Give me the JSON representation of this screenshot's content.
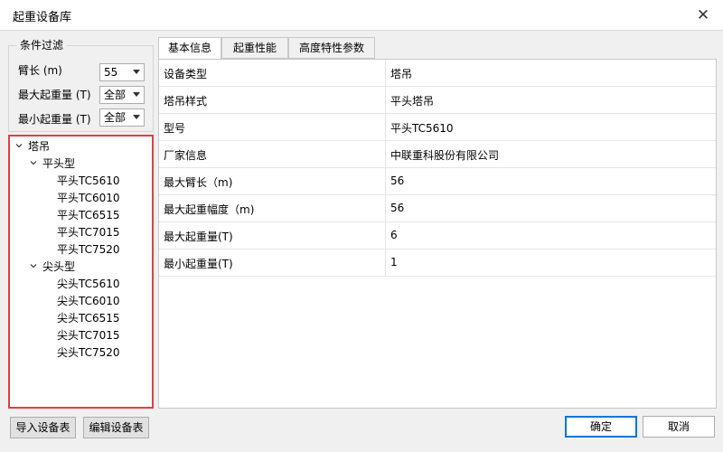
{
  "window": {
    "title": "起重设备库"
  },
  "filter": {
    "legend": "条件过滤",
    "fields": [
      {
        "label": "臂长 (m)",
        "value": "55"
      },
      {
        "label": "最大起重量 (T)",
        "value": "全部"
      },
      {
        "label": "最小起重量 (T)",
        "value": "全部"
      }
    ]
  },
  "tree": {
    "root": "塔吊",
    "groups": [
      {
        "label": "平头型",
        "items": [
          "平头TC5610",
          "平头TC6010",
          "平头TC6515",
          "平头TC7015",
          "平头TC7520"
        ]
      },
      {
        "label": "尖头型",
        "items": [
          "尖头TC5610",
          "尖头TC6010",
          "尖头TC6515",
          "尖头TC7015",
          "尖头TC7520"
        ]
      }
    ]
  },
  "tabs": [
    "基本信息",
    "起重性能",
    "高度特性参数"
  ],
  "details": [
    {
      "key": "设备类型",
      "value": "塔吊"
    },
    {
      "key": "塔吊样式",
      "value": "平头塔吊"
    },
    {
      "key": "型号",
      "value": "平头TC5610"
    },
    {
      "key": "厂家信息",
      "value": "中联重科股份有限公司"
    },
    {
      "key": "最大臂长（m)",
      "value": "56"
    },
    {
      "key": "最大起重幅度（m)",
      "value": "56"
    },
    {
      "key": "最大起重量(T)",
      "value": "6"
    },
    {
      "key": "最小起重量(T)",
      "value": "1"
    }
  ],
  "buttons": {
    "import": "导入设备表",
    "edit": "编辑设备表",
    "ok": "确定",
    "cancel": "取消"
  }
}
